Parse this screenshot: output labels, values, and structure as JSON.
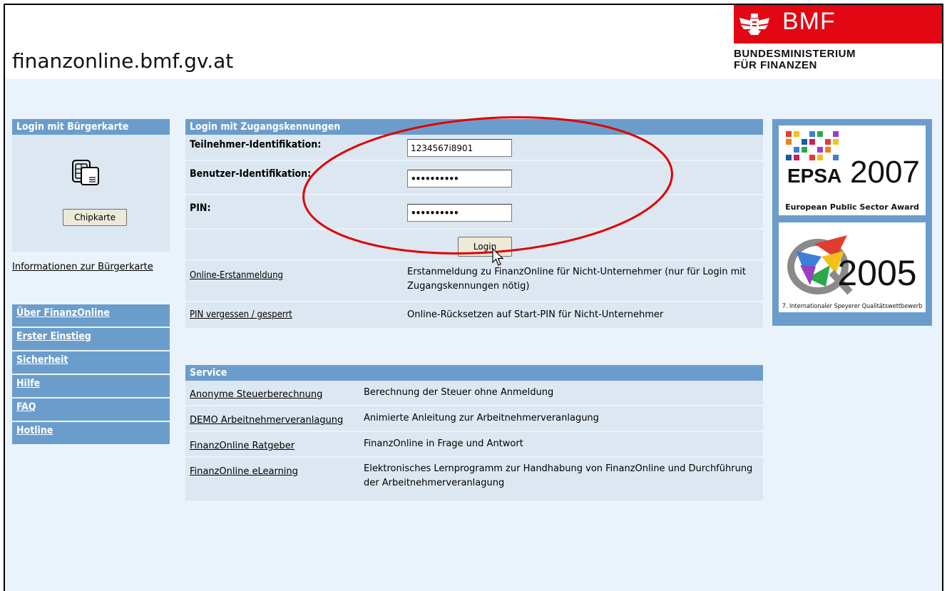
{
  "header": {
    "site_title": "finanzonline.bmf.gv.at",
    "bmf_logo_text": "BMF",
    "bmf_line1": "BUNDESMINISTERIUM",
    "bmf_line2": "FÜR FINANZEN",
    "brand_color": "#e30613"
  },
  "buergerkarte": {
    "title": "Login mit Bürgerkarte",
    "chip_button": "Chipkarte",
    "info_link": "Informationen zur Bürgerkarte",
    "icon": "smartcard-icon"
  },
  "nav": {
    "items": [
      {
        "label": "Über FinanzOnline"
      },
      {
        "label": "Erster Einstieg"
      },
      {
        "label": "Sicherheit"
      },
      {
        "label": "Hilfe"
      },
      {
        "label": "FAQ"
      },
      {
        "label": "Hotline"
      }
    ]
  },
  "login": {
    "title": "Login mit Zugangskennungen",
    "teilnehmer_label": "Teilnehmer-Identifikation:",
    "teilnehmer_value": "1234567i8901",
    "benutzer_label": "Benutzer-Identifikation:",
    "benutzer_value": "••••••••••",
    "pin_label": "PIN:",
    "pin_value": "••••••••••",
    "login_button": "Login",
    "links": [
      {
        "label": "Online-Erstanmeldung",
        "desc": "Erstanmeldung zu FinanzOnline für Nicht-Unternehmer (nur für Login mit Zugangskennungen nötig)"
      },
      {
        "label": "PIN vergessen / gesperrt",
        "desc": "Online-Rücksetzen auf Start-PIN für Nicht-Unternehmer"
      }
    ]
  },
  "service": {
    "title": "Service",
    "rows": [
      {
        "label": "Anonyme Steuerberechnung",
        "desc": "Berechnung der Steuer ohne Anmeldung"
      },
      {
        "label": "DEMO Arbeitnehmerveranlagung",
        "desc": "Animierte Anleitung zur Arbeitnehmerveranlagung"
      },
      {
        "label": "FinanzOnline Ratgeber",
        "desc": "FinanzOnline in Frage und Antwort"
      },
      {
        "label": "FinanzOnline eLearning",
        "desc": "Elektronisches Lernprogramm zur Handhabung von FinanzOnline und Durchführung der Arbeitnehmerveranlagung"
      }
    ]
  },
  "awards": {
    "epsa_logo": "EPSA",
    "epsa_year": "2007",
    "epsa_caption": "European Public Sector Award",
    "q_year": "2005",
    "q_caption": "7. Internationaler Speyerer Qualitätswettbewerb"
  },
  "colors": {
    "panel_header": "#6b9dcc",
    "panel_row": "#dde7f1",
    "page_bg": "#eaf3fb",
    "highlight_ellipse": "#e00000"
  }
}
